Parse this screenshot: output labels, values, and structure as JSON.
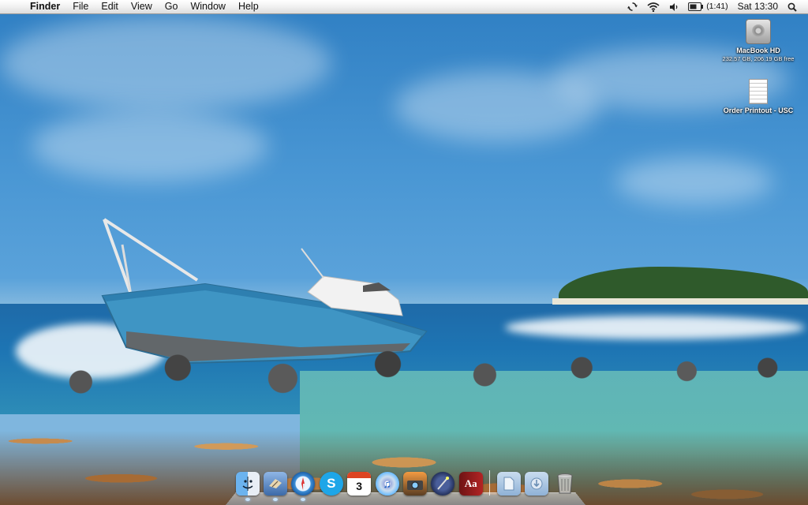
{
  "menubar": {
    "apple_symbol": "",
    "app_name": "Finder",
    "menus": [
      "File",
      "Edit",
      "View",
      "Go",
      "Window",
      "Help"
    ],
    "status": {
      "sync_icon": "time-machine-sync-icon",
      "wifi_icon": "wifi-icon",
      "volume_icon": "volume-icon",
      "battery_icon": "battery-icon",
      "battery_text": "(1:41)",
      "clock": "Sat 13:30",
      "spotlight_icon": "spotlight-search-icon"
    }
  },
  "desktop_icons": [
    {
      "name": "MacBook HD",
      "detail": "232.57 GB, 206.19 GB free",
      "icon": "hard-drive-icon"
    },
    {
      "name": "Order Printout - USC",
      "detail": "",
      "icon": "document-icon"
    }
  ],
  "dock": {
    "apps": [
      {
        "name": "Finder",
        "icon": "finder-icon",
        "running": true
      },
      {
        "name": "Mail",
        "icon": "mail-icon",
        "running": true
      },
      {
        "name": "Safari",
        "icon": "safari-icon",
        "running": true
      },
      {
        "name": "Skype",
        "icon": "skype-icon",
        "running": false
      },
      {
        "name": "iCal",
        "icon": "ical-icon",
        "day": "3",
        "running": false
      },
      {
        "name": "iTunes",
        "icon": "itunes-icon",
        "running": false
      },
      {
        "name": "iPhoto",
        "icon": "iphoto-icon",
        "running": false
      },
      {
        "name": "Aperture",
        "icon": "aperture-icon",
        "running": false
      },
      {
        "name": "Dictionary",
        "icon": "dictionary-icon",
        "glyph": "Aa",
        "running": false
      }
    ],
    "stacks": [
      {
        "name": "Documents",
        "icon": "documents-stack-icon"
      },
      {
        "name": "Downloads",
        "icon": "downloads-stack-icon"
      },
      {
        "name": "Trash",
        "icon": "trash-icon"
      }
    ]
  },
  "colors": {
    "sky": "#4a97d4",
    "sea": "#1d74b3",
    "lagoon": "#62b9b1",
    "ship_hull": "#3f95c4"
  }
}
